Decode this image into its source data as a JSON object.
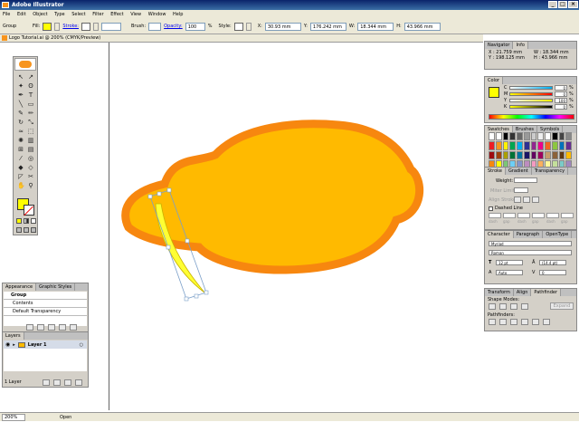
{
  "app": {
    "title": "Adobe Illustrator"
  },
  "menu": [
    "File",
    "Edit",
    "Object",
    "Type",
    "Select",
    "Filter",
    "Effect",
    "View",
    "Window",
    "Help"
  ],
  "control_bar": {
    "selection": "Group",
    "fill_label": "Fill:",
    "stroke_label": "Stroke:",
    "brush_label": "Brush:",
    "opacity_label": "Opacity:",
    "opacity_value": "100",
    "opacity_unit": "%",
    "style_label": "Style:",
    "x_label": "X:",
    "x_value": "30.93 mm",
    "y_label": "Y:",
    "y_value": "176.242 mm",
    "w_label": "W:",
    "w_value": "18.344 mm",
    "h_label": "H:",
    "h_value": "43.966 mm",
    "fill_color": "#ffff00"
  },
  "document": {
    "tab_title": "Logo Tutorial.ai @ 200% (CMYK/Preview)"
  },
  "info_panel": {
    "tabs": [
      "Navigator",
      "Info"
    ],
    "x": "X : 21.759 mm",
    "y": "Y : 198.125 mm",
    "w": "W : 18.344 mm",
    "h": "H : 43.966 mm"
  },
  "color_panel": {
    "tab": "Color",
    "channels": [
      {
        "label": "C",
        "value": "0"
      },
      {
        "label": "M",
        "value": "0"
      },
      {
        "label": "Y",
        "value": "100"
      },
      {
        "label": "K",
        "value": "0"
      }
    ],
    "unit": "%"
  },
  "swatches_panel": {
    "tabs": [
      "Swatches",
      "Brushes",
      "Symbols"
    ]
  },
  "stroke_panel": {
    "tabs": [
      "Stroke",
      "Gradient",
      "Transparency"
    ],
    "weight_label": "Weight:",
    "miter_label": "Miter Limit:",
    "align_label": "Align Stroke:",
    "dashed_label": "Dashed Line",
    "dash_labels": [
      "dash",
      "gap",
      "dash",
      "gap",
      "dash",
      "gap"
    ]
  },
  "character_panel": {
    "tabs": [
      "Character",
      "Paragraph",
      "OpenType"
    ],
    "font": "Myriad",
    "style": "Roman",
    "size": "12 pt",
    "leading": "(14.4 pt)",
    "tracking": "Auto",
    "kerning": "0"
  },
  "pathfinder_panel": {
    "tabs": [
      "Transform",
      "Align",
      "Pathfinder"
    ],
    "shape_modes_label": "Shape Modes:",
    "expand_label": "Expand",
    "pathfinders_label": "Pathfinders:"
  },
  "appearance_panel": {
    "tabs": [
      "Appearance",
      "Graphic Styles"
    ],
    "items": [
      "Group",
      "Contents",
      "Default Transparency"
    ]
  },
  "layers_panel": {
    "tab": "Layers",
    "layer_name": "Layer 1",
    "layer_count": "1 Layer"
  },
  "status_bar": {
    "zoom": "200%",
    "status": "Open"
  },
  "colors": {
    "lemon_fill": "#ffba00",
    "lemon_stroke": "#f7870f",
    "highlight": "#ffff33",
    "selection": "#7b9fc9"
  }
}
